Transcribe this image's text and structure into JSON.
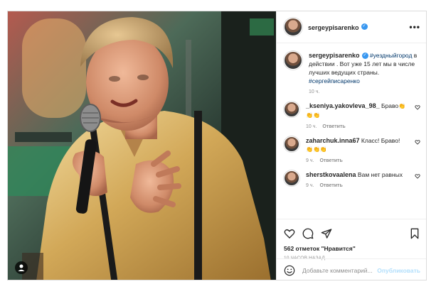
{
  "post": {
    "author": "sergeypisarenko",
    "more_label": "•••",
    "caption": {
      "author": "sergeypisarenko",
      "hashtag1": "#уездныйгород",
      "text": " в действии . Вот уже 15 лет мы в числе лучших ведущих страны.",
      "hashtag2": "#сергейписаренко",
      "time": "10 ч."
    },
    "comments": [
      {
        "user": "_kseniya.yakovleva_98_",
        "text": "Браво",
        "emoji": "👏👏👏",
        "time": "10 ч.",
        "reply": "Ответить"
      },
      {
        "user": "zaharchuk.inna67",
        "text": "Класс! Браво!",
        "emoji": "👏👏👏",
        "time": "9 ч.",
        "reply": "Ответить"
      },
      {
        "user": "sherstkovaalena",
        "text": "Вам нет равных",
        "emoji": "",
        "time": "9 ч.",
        "reply": "Ответить"
      }
    ],
    "likes": "562 отметок \"Нравится\"",
    "ago": "10 ЧАСОВ НАЗАД",
    "add_comment_placeholder": "Добавьте комментарий...",
    "publish_label": "Опубликовать"
  },
  "colors": {
    "verified": "#3897f0",
    "link": "#00376b",
    "publish": "#b2dffc",
    "shirt": "#d8b46a"
  }
}
